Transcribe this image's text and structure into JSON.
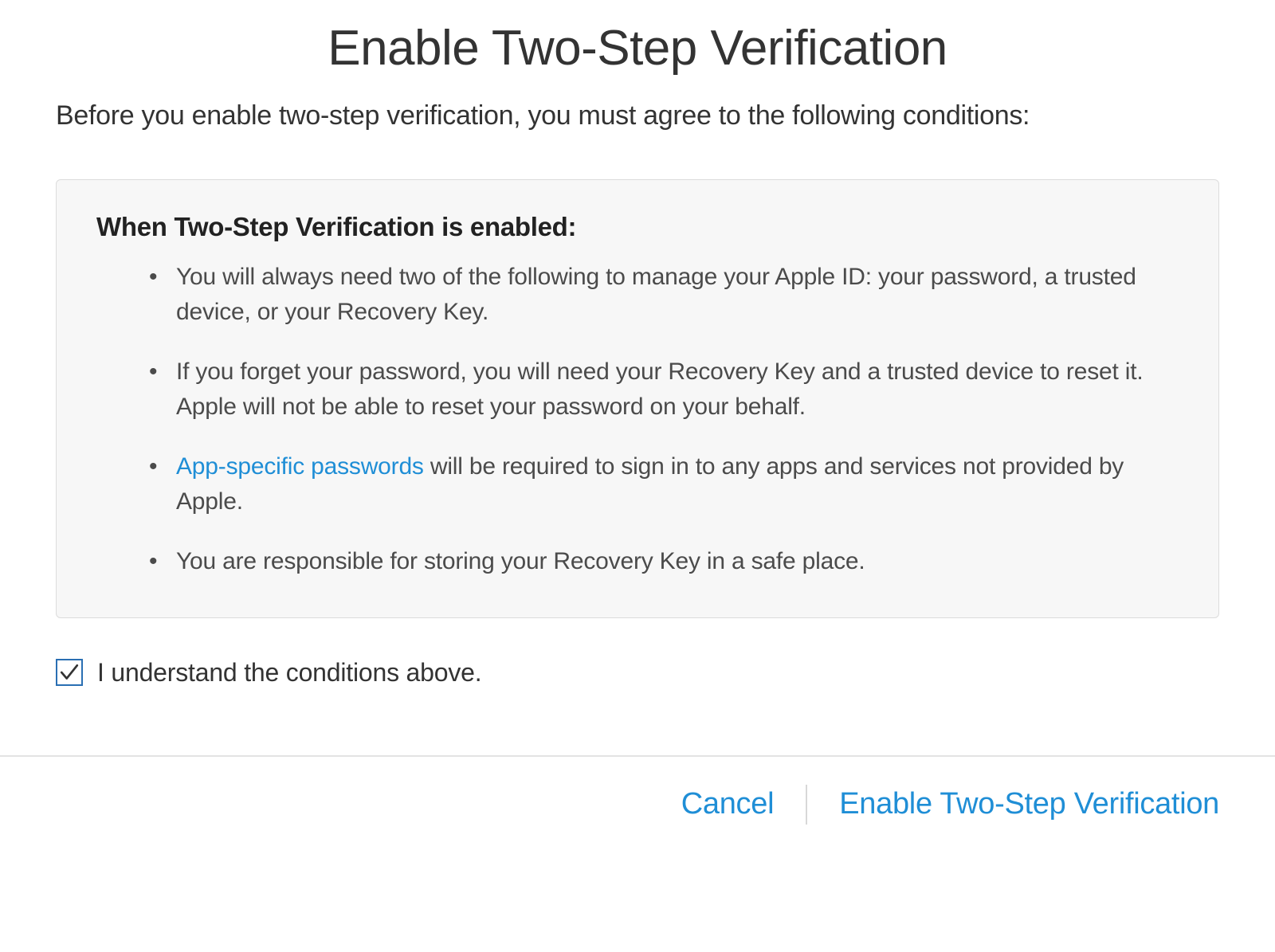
{
  "title": "Enable Two-Step Verification",
  "subtitle": "Before you enable two-step verification, you must agree to the following conditions:",
  "box_heading": "When Two-Step Verification is enabled:",
  "conditions": {
    "item1": "You will always need two of the following to manage your Apple ID: your password, a trusted device, or your Recovery Key.",
    "item2": "If you forget your password, you will need your Recovery Key and a trusted device to reset it. Apple will not be able to reset your password on your behalf.",
    "item3_link": "App-specific passwords",
    "item3_rest": " will be required to sign in to any apps and services not provided by Apple.",
    "item4": "You are responsible for storing your Recovery Key in a safe place."
  },
  "agree": {
    "checked": true,
    "label": "I understand the conditions above."
  },
  "footer": {
    "cancel": "Cancel",
    "enable": "Enable Two-Step Verification"
  }
}
